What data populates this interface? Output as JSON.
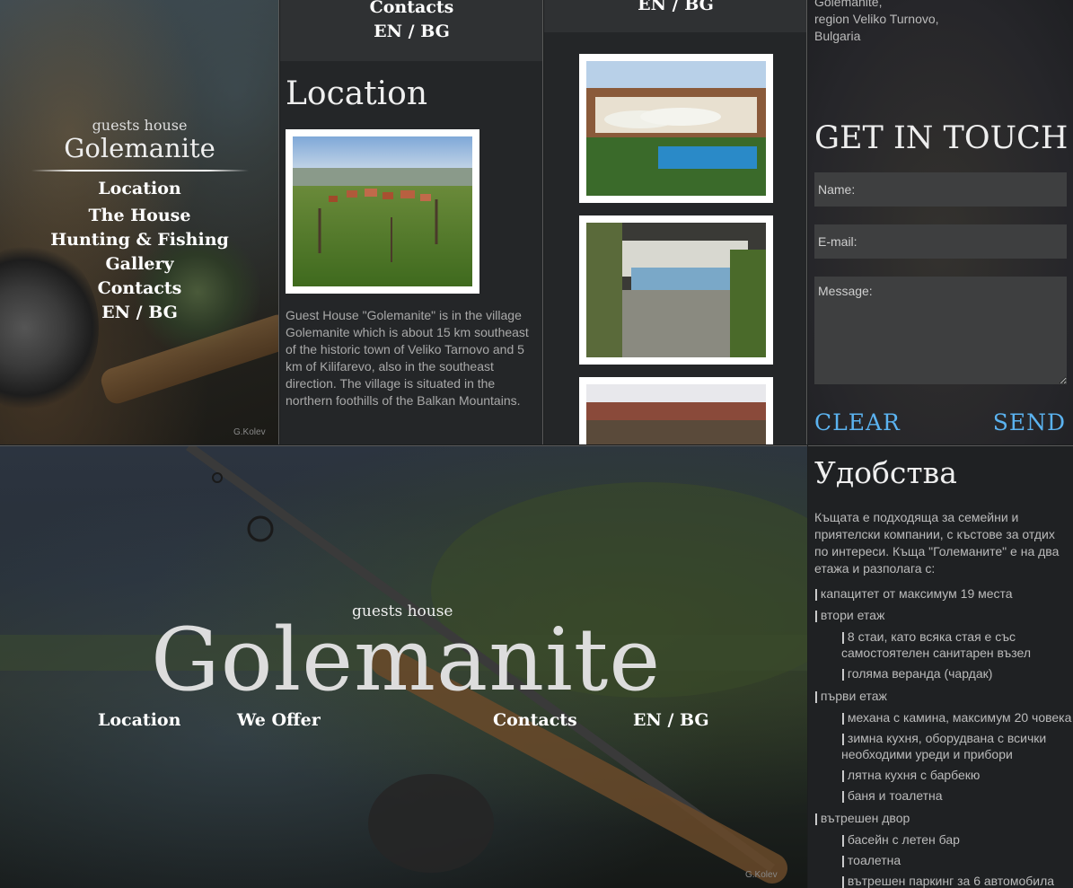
{
  "sidebar": {
    "tagline": "guests house",
    "title": "Golemanite",
    "nav": [
      {
        "label": "Location"
      },
      {
        "label": "The House"
      },
      {
        "label": "Hunting & Fishing"
      },
      {
        "label": "Gallery"
      },
      {
        "label": "Contacts"
      },
      {
        "label": "EN / BG"
      }
    ],
    "credit": "G.Kolev"
  },
  "location": {
    "topbar_contacts": "Contacts",
    "topbar_lang": "EN / BG",
    "heading": "Location",
    "paragraph": "Guest House \"Golemanite\" is in the village Golemanite which is about 15 km southeast of the historic town of Veliko Tarnovo and 5 km of Kilifarevo, also in the southeast direction. The village is situated in the northern foothills of the Balkan Mountains."
  },
  "gallery": {
    "topbar_lang": "EN / BG"
  },
  "contact": {
    "address_lines": [
      "Golemanite,",
      "region Veliko Turnovo,",
      "Bulgaria"
    ],
    "heading": "GET IN TOUCH",
    "name_placeholder": "Name:",
    "email_placeholder": "E-mail:",
    "message_placeholder": "Message:",
    "clear_label": "CLEAR",
    "send_label": "SEND",
    "accent_color": "#5bb3f0"
  },
  "hero": {
    "tagline": "guests house",
    "title": "Golemanite",
    "nav": [
      {
        "label": "Location"
      },
      {
        "label": "We Offer"
      },
      {
        "label": "Contacts"
      },
      {
        "label": "EN / BG"
      }
    ],
    "credit": "G.Kolev"
  },
  "amenities": {
    "heading": "Удобства",
    "intro": "Къщата е подходяща за семейни и приятелски компании, с къстове за отдих по интереси. Къща \"Големаните\" е на два етажа и разполага с:",
    "items": [
      {
        "text": "капацитет от максимум 19 места"
      },
      {
        "text": "втори етаж"
      },
      {
        "text": "8 стаи, като всяка стая е със"
      },
      {
        "text": "самостоятелен санитарен възел"
      },
      {
        "text": "голяма веранда (чардак)"
      },
      {
        "text": "първи етаж"
      },
      {
        "text": "механа с камина, максимум 20 човека"
      },
      {
        "text": "зимна кухня, оборудвана с всички"
      },
      {
        "text": "необходими уреди и прибори"
      },
      {
        "text": "лятна кухня с барбекю"
      },
      {
        "text": "баня и тоалетна"
      },
      {
        "text": "вътрешен двор"
      },
      {
        "text": "басейн с летен бар"
      },
      {
        "text": "тоалетна"
      },
      {
        "text": "вътрешен паркинг за 6 автомобила"
      }
    ]
  }
}
